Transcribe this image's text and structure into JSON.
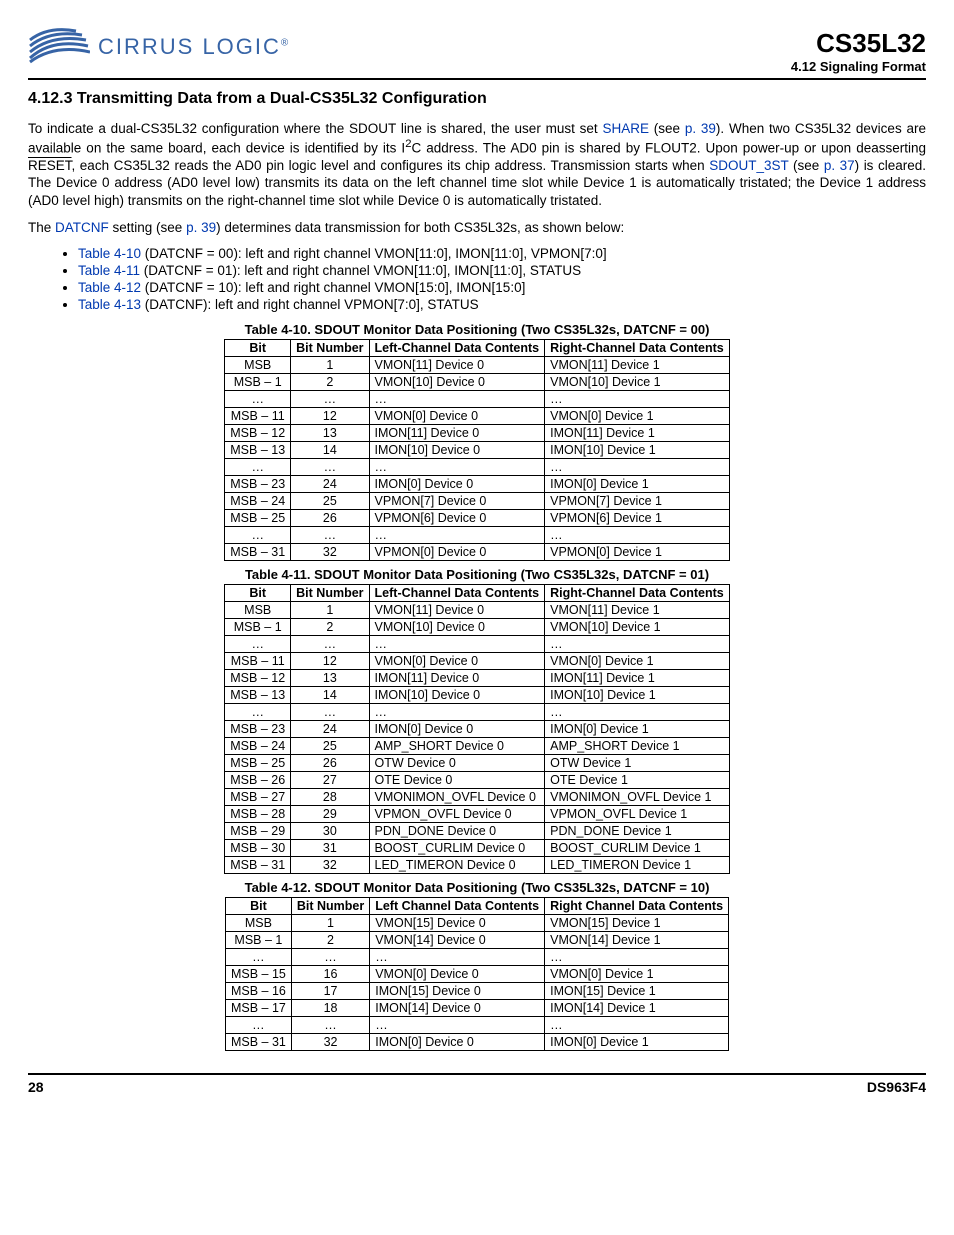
{
  "header": {
    "brand": "CIRRUS LOGIC",
    "brand_reg": "®",
    "part": "CS35L32",
    "section_label": "4.12 Signaling Format"
  },
  "heading": "4.12.3   Transmitting Data from a Dual-CS35L32 Configuration",
  "para1_a": "To indicate a dual-CS35L32 configuration where the SDOUT line is shared, the user must set ",
  "para1_share": "SHARE",
  "para1_b": " (see ",
  "para1_p39": "p. 39",
  "para1_c": "). When two CS35L32 devices are available on the same board, each device is identified by its I",
  "para1_i2c_sup": "2",
  "para1_d": "C address. The AD0 pin is shared by FLOUT2. Upon power-up or upon deasserting ",
  "para1_reset": "RESET",
  "para1_e": ", each CS35L32 reads the AD0 pin logic level and configures its chip address. Transmission starts when ",
  "para1_sdout3st": "SDOUT_3ST",
  "para1_f": " (see ",
  "para1_p37": "p. 37",
  "para1_g": ") is cleared. The Device 0 address (AD0 level low) transmits its data on the left channel time slot while Device 1 is automatically tristated; the Device 1 address (AD0 level high) transmits on the right-channel time slot while Device 0 is automatically tristated.",
  "para2_a": "The ",
  "para2_datcnf": "DATCNF",
  "para2_b": " setting (see ",
  "para2_p39": "p. 39",
  "para2_c": ") determines data transmission for both CS35L32s, as shown below:",
  "bullets": [
    {
      "link": "Table 4-10",
      "rest": " (DATCNF = 00): left and right channel VMON[11:0], IMON[11:0], VPMON[7:0]"
    },
    {
      "link": "Table 4-11",
      "rest": " (DATCNF = 01): left and right channel VMON[11:0], IMON[11:0], STATUS"
    },
    {
      "link": "Table 4-12",
      "rest": " (DATCNF = 10): left and right channel VMON[15:0], IMON[15:0]"
    },
    {
      "link": "Table 4-13",
      "rest": " (DATCNF): left and right channel VPMON[7:0], STATUS"
    }
  ],
  "table10": {
    "caption": "Table 4-10.  SDOUT Monitor Data Positioning (Two CS35L32s, DATCNF = 00)",
    "headers": [
      "Bit",
      "Bit Number",
      "Left-Channel Data Contents",
      "Right-Channel Data Contents"
    ],
    "rows": [
      [
        "MSB",
        "1",
        "VMON[11] Device 0",
        "VMON[11] Device 1"
      ],
      [
        "MSB – 1",
        "2",
        "VMON[10] Device 0",
        "VMON[10] Device 1"
      ],
      [
        "…",
        "…",
        "…",
        "…"
      ],
      [
        "MSB – 11",
        "12",
        "VMON[0] Device 0",
        "VMON[0] Device 1"
      ],
      [
        "MSB – 12",
        "13",
        "IMON[11] Device 0",
        "IMON[11] Device 1"
      ],
      [
        "MSB – 13",
        "14",
        "IMON[10] Device 0",
        "IMON[10] Device 1"
      ],
      [
        "…",
        "…",
        "…",
        "…"
      ],
      [
        "MSB – 23",
        "24",
        "IMON[0] Device 0",
        "IMON[0] Device 1"
      ],
      [
        "MSB – 24",
        "25",
        "VPMON[7] Device 0",
        "VPMON[7] Device 1"
      ],
      [
        "MSB – 25",
        "26",
        "VPMON[6] Device 0",
        "VPMON[6] Device 1"
      ],
      [
        "…",
        "…",
        "…",
        "…"
      ],
      [
        "MSB – 31",
        "32",
        "VPMON[0] Device 0",
        "VPMON[0] Device 1"
      ]
    ]
  },
  "table11": {
    "caption": "Table 4-11.  SDOUT Monitor Data Positioning (Two CS35L32s, DATCNF = 01)",
    "headers": [
      "Bit",
      "Bit Number",
      "Left-Channel Data Contents",
      "Right-Channel Data Contents"
    ],
    "rows": [
      [
        "MSB",
        "1",
        "VMON[11] Device 0",
        "VMON[11] Device 1"
      ],
      [
        "MSB – 1",
        "2",
        "VMON[10] Device 0",
        "VMON[10] Device 1"
      ],
      [
        "…",
        "…",
        "…",
        "…"
      ],
      [
        "MSB – 11",
        "12",
        "VMON[0] Device 0",
        "VMON[0] Device 1"
      ],
      [
        "MSB – 12",
        "13",
        "IMON[11] Device 0",
        "IMON[11] Device 1"
      ],
      [
        "MSB – 13",
        "14",
        "IMON[10] Device 0",
        "IMON[10] Device 1"
      ],
      [
        "…",
        "…",
        "…",
        "…"
      ],
      [
        "MSB – 23",
        "24",
        "IMON[0] Device 0",
        "IMON[0] Device 1"
      ],
      [
        "MSB – 24",
        "25",
        "AMP_SHORT Device 0",
        "AMP_SHORT Device 1"
      ],
      [
        "MSB – 25",
        "26",
        "OTW Device 0",
        "OTW Device 1"
      ],
      [
        "MSB – 26",
        "27",
        "OTE Device 0",
        "OTE Device 1"
      ],
      [
        "MSB – 27",
        "28",
        "VMONIMON_OVFL Device 0",
        "VMONIMON_OVFL Device 1"
      ],
      [
        "MSB – 28",
        "29",
        "VPMON_OVFL Device 0",
        "VPMON_OVFL Device 1"
      ],
      [
        "MSB – 29",
        "30",
        "PDN_DONE Device 0",
        "PDN_DONE Device 1"
      ],
      [
        "MSB – 30",
        "31",
        "BOOST_CURLIM Device 0",
        "BOOST_CURLIM Device 1"
      ],
      [
        "MSB – 31",
        "32",
        "LED_TIMERON Device 0",
        "LED_TIMERON Device 1"
      ]
    ]
  },
  "table12": {
    "caption": "Table 4-12.  SDOUT Monitor Data Positioning (Two CS35L32s, DATCNF = 10)",
    "headers": [
      "Bit",
      "Bit Number",
      "Left Channel Data Contents",
      "Right Channel Data Contents"
    ],
    "rows": [
      [
        "MSB",
        "1",
        "VMON[15] Device 0",
        "VMON[15] Device 1"
      ],
      [
        "MSB – 1",
        "2",
        "VMON[14] Device 0",
        "VMON[14] Device 1"
      ],
      [
        "…",
        "…",
        "…",
        "…"
      ],
      [
        "MSB – 15",
        "16",
        "VMON[0] Device 0",
        "VMON[0] Device 1"
      ],
      [
        "MSB – 16",
        "17",
        "IMON[15] Device 0",
        "IMON[15] Device 1"
      ],
      [
        "MSB – 17",
        "18",
        "IMON[14] Device 0",
        "IMON[14] Device 1"
      ],
      [
        "…",
        "…",
        "…",
        "…"
      ],
      [
        "MSB – 31",
        "32",
        "IMON[0] Device 0",
        "IMON[0] Device 1"
      ]
    ]
  },
  "footer": {
    "page": "28",
    "doc": "DS963F4"
  }
}
